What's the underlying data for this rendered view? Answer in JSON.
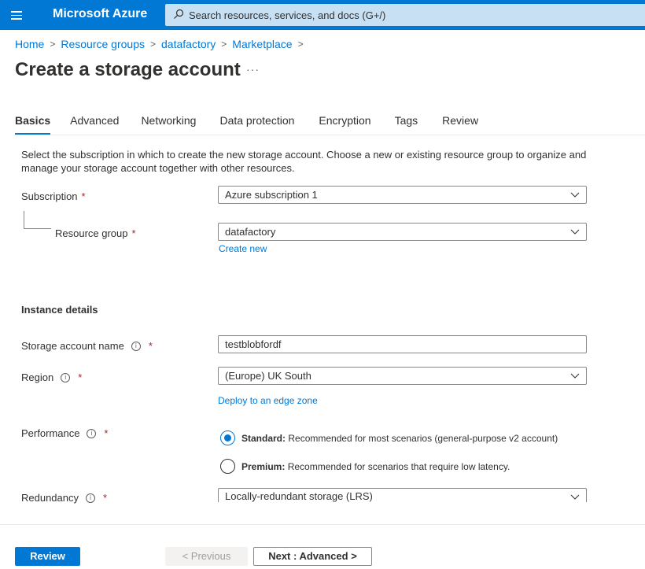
{
  "topbar": {
    "brand": "Microsoft Azure",
    "search_placeholder": "Search resources, services, and docs (G+/)"
  },
  "breadcrumb": [
    "Home",
    "Resource groups",
    "datafactory",
    "Marketplace"
  ],
  "page": {
    "title": "Create a storage account",
    "more": "···"
  },
  "tabs": [
    "Basics",
    "Advanced",
    "Networking",
    "Data protection",
    "Encryption",
    "Tags",
    "Review"
  ],
  "active_tab": "Basics",
  "intro": "Select the subscription in which to create the new storage account. Choose a new or existing resource group to organize and manage your storage account together with other resources.",
  "form": {
    "subscription": {
      "label": "Subscription",
      "value": "Azure subscription 1"
    },
    "resource_group": {
      "label": "Resource group",
      "value": "datafactory",
      "create_new": "Create new"
    },
    "instance_heading": "Instance details",
    "storage_account_name": {
      "label": "Storage account name",
      "value": "testblobfordf"
    },
    "region": {
      "label": "Region",
      "value": "(Europe) UK South",
      "edge_link": "Deploy to an edge zone"
    },
    "performance": {
      "label": "Performance",
      "options": [
        {
          "title": "Standard:",
          "desc": "Recommended for most scenarios (general-purpose v2 account)",
          "checked": true
        },
        {
          "title": "Premium:",
          "desc": "Recommended for scenarios that require low latency.",
          "checked": false
        }
      ]
    },
    "redundancy": {
      "label": "Redundancy",
      "value": "Locally-redundant storage (LRS)"
    },
    "required_mark": "*",
    "info_mark": "i"
  },
  "footer": {
    "review": "Review",
    "previous": "< Previous",
    "next": "Next : Advanced >"
  },
  "colors": {
    "accent": "#0078d4",
    "search_bg": "#c7e0f4",
    "required": "#a4262c"
  }
}
